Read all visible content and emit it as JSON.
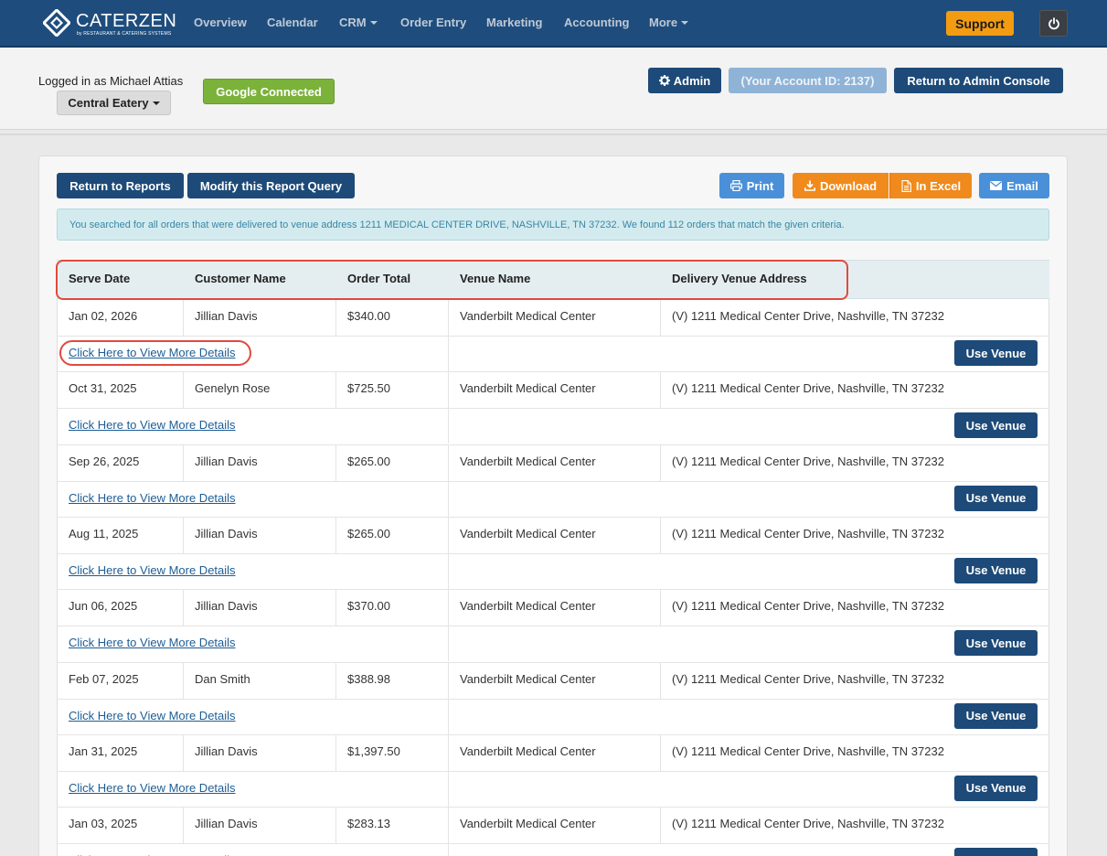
{
  "nav": {
    "logo_text": "CaterZen",
    "logo_subtext": "by RESTAURANT & CATERING SYSTEMS",
    "items": [
      {
        "label": "Overview",
        "has_caret": false
      },
      {
        "label": "Calendar",
        "has_caret": false
      },
      {
        "label": "CRM",
        "has_caret": true
      },
      {
        "label": "Order Entry",
        "has_caret": false
      },
      {
        "label": "Marketing",
        "has_caret": false
      },
      {
        "label": "Accounting",
        "has_caret": false
      },
      {
        "label": "More",
        "has_caret": true
      }
    ],
    "support_label": "Support",
    "power_icon": "power-icon"
  },
  "account": {
    "logged_in_text": "Logged in as Michael Attias",
    "restaurant": "Central Eatery",
    "google_status": "Google Connected",
    "admin_label": "Admin",
    "account_id_label": "(Your Account ID: 2137)",
    "return_admin_label": "Return to Admin Console"
  },
  "toolbar": {
    "return_reports": "Return to Reports",
    "modify_query": "Modify this Report Query",
    "print": "Print",
    "download": "Download",
    "in_excel": "In Excel",
    "email": "Email"
  },
  "info_message": "You searched for all orders that were delivered to venue address 1211 MEDICAL CENTER DRIVE, NASHVILLE, TN 37232. We found 112 orders that match the given criteria.",
  "table": {
    "columns": [
      "Serve Date",
      "Customer Name",
      "Order Total",
      "Venue Name",
      "Delivery Venue Address"
    ],
    "details_link": "Click Here to View More Details",
    "use_venue_label": "Use Venue",
    "rows": [
      {
        "serve_date": "Jan 02, 2026",
        "customer": "Jillian Davis",
        "total": "$340.00",
        "venue": "Vanderbilt Medical Center",
        "address": "(V) 1211 Medical Center Drive, Nashville, TN 37232"
      },
      {
        "serve_date": "Oct 31, 2025",
        "customer": "Genelyn Rose",
        "total": "$725.50",
        "venue": "Vanderbilt Medical Center",
        "address": "(V) 1211 Medical Center Drive, Nashville, TN 37232"
      },
      {
        "serve_date": "Sep 26, 2025",
        "customer": "Jillian Davis",
        "total": "$265.00",
        "venue": "Vanderbilt Medical Center",
        "address": "(V) 1211 Medical Center Drive, Nashville, TN 37232"
      },
      {
        "serve_date": "Aug 11, 2025",
        "customer": "Jillian Davis",
        "total": "$265.00",
        "venue": "Vanderbilt Medical Center",
        "address": "(V) 1211 Medical Center Drive, Nashville, TN 37232"
      },
      {
        "serve_date": "Jun 06, 2025",
        "customer": "Jillian Davis",
        "total": "$370.00",
        "venue": "Vanderbilt Medical Center",
        "address": "(V) 1211 Medical Center Drive, Nashville, TN 37232"
      },
      {
        "serve_date": "Feb 07, 2025",
        "customer": "Dan Smith",
        "total": "$388.98",
        "venue": "Vanderbilt Medical Center",
        "address": "(V) 1211 Medical Center Drive, Nashville, TN 37232"
      },
      {
        "serve_date": "Jan 31, 2025",
        "customer": "Jillian Davis",
        "total": "$1,397.50",
        "venue": "Vanderbilt Medical Center",
        "address": "(V) 1211 Medical Center Drive, Nashville, TN 37232"
      },
      {
        "serve_date": "Jan 03, 2025",
        "customer": "Jillian Davis",
        "total": "$283.13",
        "venue": "Vanderbilt Medical Center",
        "address": "(V) 1211 Medical Center Drive, Nashville, TN 37232"
      }
    ]
  },
  "colors": {
    "nav_bg": "#1e4d7d",
    "primary": "#1d4a78",
    "support": "#f39c12",
    "google": "#7bb23a",
    "download": "#f08a1c",
    "email": "#4a90d9",
    "highlight": "#e04a3f"
  }
}
